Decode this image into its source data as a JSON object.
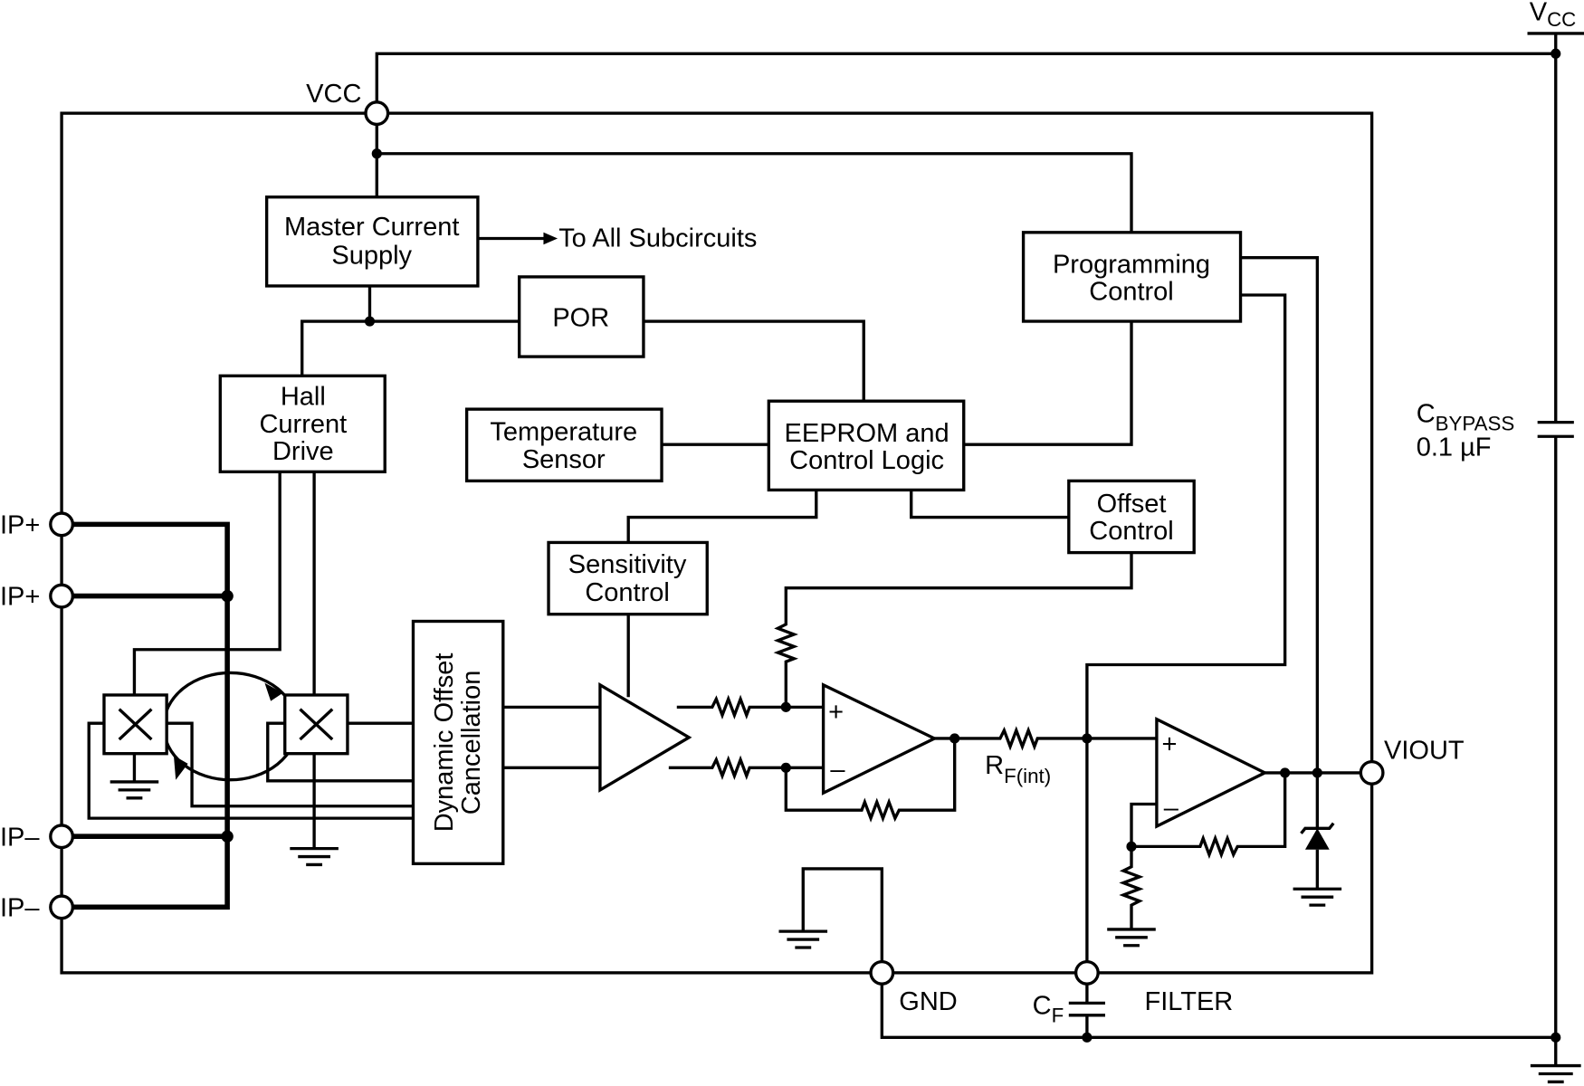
{
  "supply": {
    "label": "V",
    "sub": "CC"
  },
  "pins": {
    "vcc": "VCC",
    "ip_plus_1": "IP+",
    "ip_plus_2": "IP+",
    "ip_minus_1": "IP–",
    "ip_minus_2": "IP–",
    "viout": "VIOUT",
    "gnd": "GND",
    "filter": "FILTER"
  },
  "blocks": {
    "master_current_supply": [
      "Master Current",
      "Supply"
    ],
    "to_all_subcircuits": "To All Subcircuits",
    "por": "POR",
    "hall_current_drive": [
      "Hall",
      "Current",
      "Drive"
    ],
    "temperature_sensor": [
      "Temperature",
      "Sensor"
    ],
    "eeprom_control_logic": [
      "EEPROM and",
      "Control Logic"
    ],
    "programming_control": [
      "Programming",
      "Control"
    ],
    "offset_control": [
      "Offset",
      "Control"
    ],
    "sensitivity_control": [
      "Sensitivity",
      "Control"
    ],
    "dynamic_offset_cancellation": [
      "Dynamic Offset",
      "Cancellation"
    ]
  },
  "components": {
    "opamp_plus": "+",
    "opamp_minus": "–",
    "rf": {
      "label": "R",
      "sub": "F(int)"
    },
    "cf": {
      "label": "C",
      "sub": "F"
    },
    "cbypass": {
      "label": "C",
      "sub": "BYPASS",
      "value": "0.1 µF"
    }
  }
}
